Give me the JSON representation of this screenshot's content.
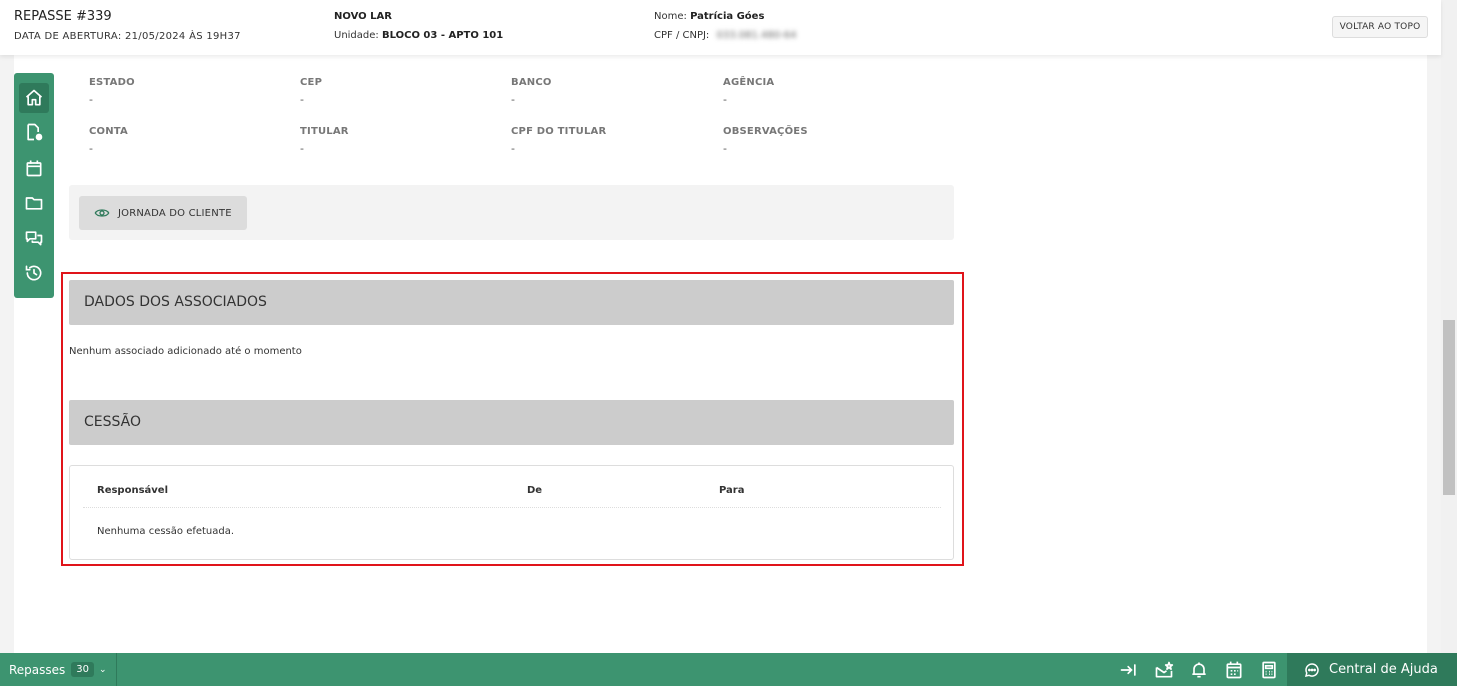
{
  "header": {
    "title": "REPASSE #339",
    "opening_date": "DATA DE ABERTURA: 21/05/2024 ÀS 19H37",
    "enterprise": "NOVO LAR",
    "unit_label": "Unidade:",
    "unit_value": "BLOCO 03 - APTO 101",
    "name_label": "Nome:",
    "name_value": "Patrícia Góes",
    "cpf_label": "CPF / CNPJ:",
    "cpf_value": "033.081.480-64",
    "back_to_top": "VOLTAR AO TOPO"
  },
  "sidenav": {
    "icons": [
      "home-icon",
      "document-badge-icon",
      "calendar-icon",
      "folder-icon",
      "chat-icon",
      "history-icon"
    ]
  },
  "fields": {
    "estado": {
      "label": "ESTADO",
      "value": "-"
    },
    "cep": {
      "label": "CEP",
      "value": "-"
    },
    "banco": {
      "label": "BANCO",
      "value": "-"
    },
    "agencia": {
      "label": "AGÊNCIA",
      "value": "-"
    },
    "conta": {
      "label": "CONTA",
      "value": "-"
    },
    "titular": {
      "label": "TITULAR",
      "value": "-"
    },
    "cpf_titular": {
      "label": "CPF DO TITULAR",
      "value": "-"
    },
    "observacoes": {
      "label": "OBSERVAÇÕES",
      "value": "-"
    }
  },
  "journey_button": "JORNADA DO CLIENTE",
  "associates": {
    "title": "DADOS DOS ASSOCIADOS",
    "empty": "Nenhum associado adicionado até o momento"
  },
  "cessao": {
    "title": "CESSÃO",
    "columns": [
      "Responsável",
      "De",
      "Para"
    ],
    "empty": "Nenhuma cessão efetuada."
  },
  "bottom_bar": {
    "repasses_label": "Repasses",
    "repasses_count": "30",
    "help_label": "Central de Ajuda"
  },
  "colors": {
    "brand_green": "#3d9470",
    "brand_green_dark": "#2f7a5b",
    "highlight_red": "#e0141a"
  }
}
